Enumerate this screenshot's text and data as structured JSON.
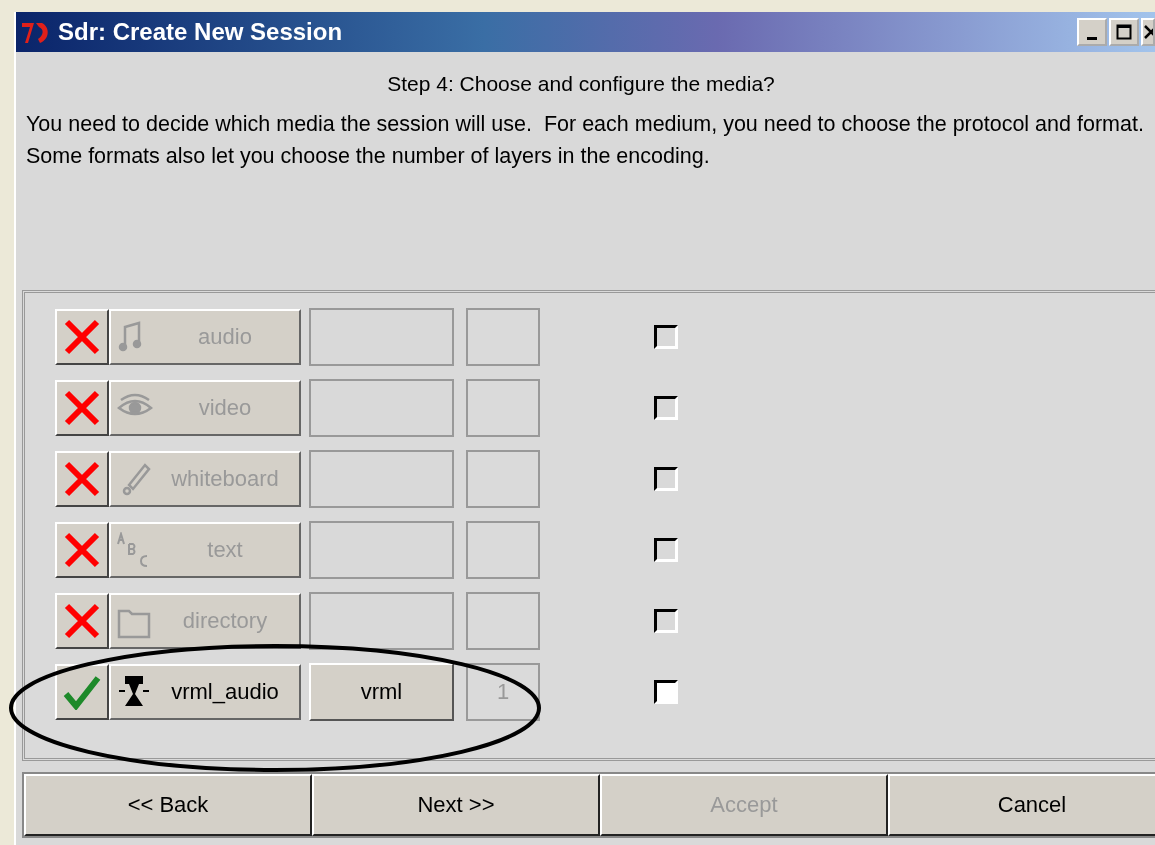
{
  "window": {
    "title": "Sdr: Create New Session"
  },
  "step_title": "Step 4: Choose and configure the media?",
  "instructions": "You need to decide which media the session will use.  For each medium, you need to choose the protocol and format.  Some formats also let you choose the number of layers in the encoding.",
  "media": [
    {
      "kind": "audio",
      "enabled": false,
      "label": "audio",
      "checked": false
    },
    {
      "kind": "video",
      "enabled": false,
      "label": "video",
      "checked": false
    },
    {
      "kind": "whiteboard",
      "enabled": false,
      "label": "whiteboard",
      "checked": false
    },
    {
      "kind": "text",
      "enabled": false,
      "label": "text",
      "checked": false
    },
    {
      "kind": "directory",
      "enabled": false,
      "label": "directory",
      "checked": false
    },
    {
      "kind": "vrml",
      "enabled": true,
      "label": "vrml_audio",
      "protocol": "vrml",
      "layers": "1",
      "checked": false
    }
  ],
  "buttons": [
    {
      "label": "<< Back",
      "disabled": false
    },
    {
      "label": "Next >>",
      "disabled": false
    },
    {
      "label": "Accept",
      "disabled": true
    },
    {
      "label": "Cancel",
      "disabled": false
    }
  ]
}
